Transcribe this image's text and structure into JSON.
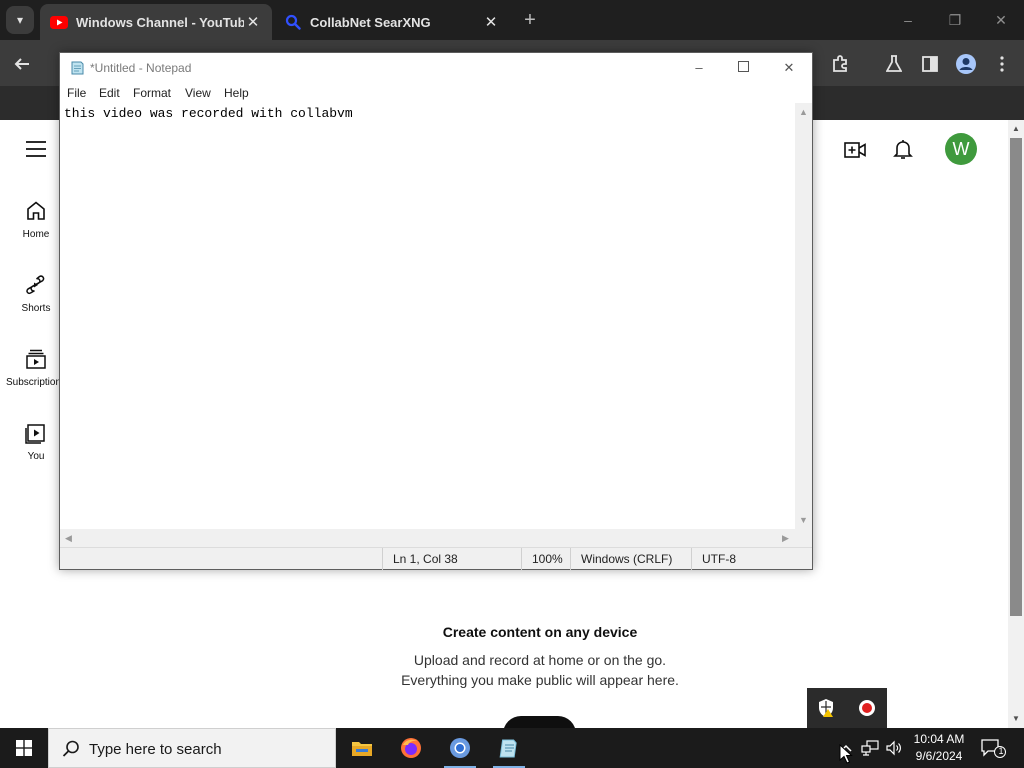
{
  "browser": {
    "tabs": [
      {
        "title": "Windows Channel - YouTube",
        "active": true
      },
      {
        "title": "CollabNet SearXNG",
        "active": false
      }
    ],
    "tab_close_glyph": "✕",
    "new_tab_glyph": "+",
    "window_controls": [
      "–",
      "❐",
      "✕"
    ],
    "toolbar_icons": [
      "back-icon",
      "extensions-icon",
      "labs-icon",
      "side-panel-icon",
      "profile-icon",
      "more-menu-icon"
    ]
  },
  "youtube": {
    "sidebar": [
      {
        "label": "Home",
        "icon": "home-icon"
      },
      {
        "label": "Shorts",
        "icon": "shorts-icon"
      },
      {
        "label": "Subscriptions",
        "icon": "subscriptions-icon"
      },
      {
        "label": "You",
        "icon": "you-icon"
      }
    ],
    "avatar_letter": "W",
    "create_title": "Create content on any device",
    "create_desc_line1": "Upload and record at home or on the go.",
    "create_desc_line2": "Everything you make public will appear here."
  },
  "notepad": {
    "title": "*Untitled - Notepad",
    "menu": [
      "File",
      "Edit",
      "Format",
      "View",
      "Help"
    ],
    "content": "this video was recorded with collabvm",
    "status": {
      "position": "Ln 1, Col 38",
      "zoom": "100%",
      "line_ending": "Windows (CRLF)",
      "encoding": "UTF-8"
    }
  },
  "taskbar": {
    "search_placeholder": "Type here to search",
    "apps": [
      "file-explorer-icon",
      "firefox-icon",
      "chromium-icon",
      "notepad-icon"
    ],
    "time": "10:04 AM",
    "date": "9/6/2024",
    "notification_count": "1"
  },
  "colors": {
    "youtube_red": "#ff0000",
    "avatar_green": "#3f9a3d",
    "searxng_blue": "#3050ff",
    "record_red": "#e02020"
  }
}
